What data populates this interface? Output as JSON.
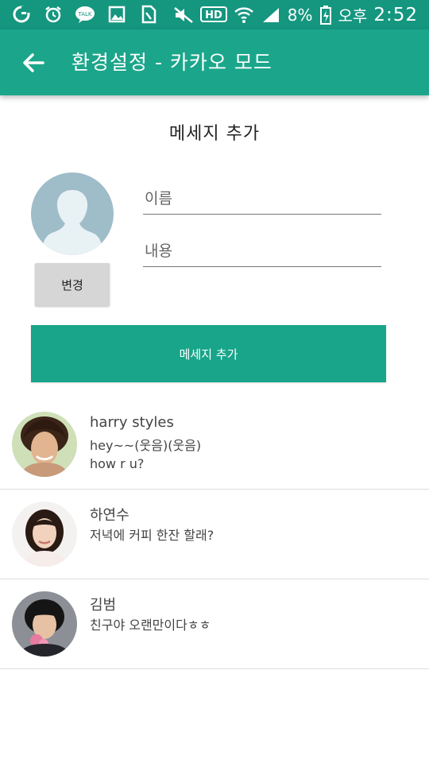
{
  "status_bar": {
    "battery_percent": "8%",
    "ampm": "오후",
    "time": "2:52"
  },
  "app_bar": {
    "title": "환경설정 - 카카오 모드"
  },
  "form": {
    "title": "메세지 추가",
    "change_button": "변경",
    "name_placeholder": "이름",
    "content_placeholder": "내용",
    "add_button": "메세지 추가"
  },
  "messages": [
    {
      "name": "harry styles",
      "lines": [
        "hey~~(웃음)(웃음)",
        "how r u?"
      ]
    },
    {
      "name": "하연수",
      "lines": [
        "저녁에 커피 한잔 할래?"
      ]
    },
    {
      "name": "김범",
      "lines": [
        "친구야 오랜만이다ㅎㅎ"
      ]
    }
  ],
  "colors": {
    "status_bar": "#15967f",
    "app_bar": "#1ba68b",
    "accent_button": "#18a58a",
    "avatar_placeholder": "#9fbcc9"
  }
}
